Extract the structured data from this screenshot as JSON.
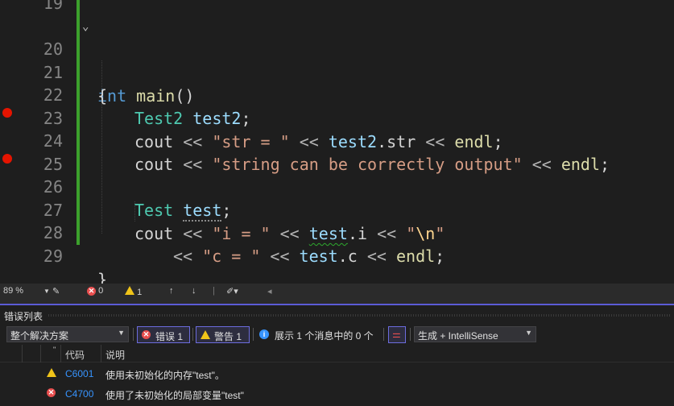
{
  "editor": {
    "lines": [
      {
        "num": "19"
      },
      {
        "num": "20"
      },
      {
        "num": "21"
      },
      {
        "num": "22"
      },
      {
        "num": "23"
      },
      {
        "num": "24"
      },
      {
        "num": "25"
      },
      {
        "num": "26"
      },
      {
        "num": "27"
      },
      {
        "num": "28"
      },
      {
        "num": "29"
      }
    ],
    "tokens": {
      "l20": [
        "int",
        " ",
        "main",
        "()"
      ],
      "l21": [
        "{"
      ],
      "l22": [
        "Test2",
        " ",
        "test2",
        ";"
      ],
      "l23": [
        "cout",
        " << ",
        "\"str = \"",
        " << ",
        "test2",
        ".",
        "str",
        " << ",
        "endl",
        ";"
      ],
      "l24": [
        "cout",
        " << ",
        "\"string can be correctly output\"",
        " << ",
        "endl",
        ";"
      ],
      "l26": [
        "Test",
        " ",
        "test",
        ";"
      ],
      "l27": [
        "cout",
        " << ",
        "\"i = \"",
        " << ",
        "test",
        ".",
        "i",
        " << ",
        "\"",
        "\\n",
        "\""
      ],
      "l28": [
        "<< ",
        "\"c = \"",
        " << ",
        "test",
        ".",
        "c",
        " << ",
        "endl",
        ";"
      ],
      "l29": [
        "}"
      ]
    },
    "fold_glyph": "⌄"
  },
  "statusbar": {
    "zoom": "89 %",
    "errors": "0",
    "warnings": "1",
    "up": "↑",
    "down": "↓",
    "left_arrow": "◂"
  },
  "error_list": {
    "title": "错误列表",
    "scope": "整个解决方案",
    "errors_btn": "错误 1",
    "warnings_btn": "警告 1",
    "messages_btn": "展示 1 个消息中的 0 个",
    "build_filter": "生成 + IntelliSense",
    "columns": {
      "code": "代码",
      "desc": "说明"
    },
    "rows": [
      {
        "type": "warning",
        "code": "C6001",
        "desc": "使用未初始化的内存\"test\"。"
      },
      {
        "type": "error",
        "code": "C4700",
        "desc": "使用了未初始化的局部变量\"test\""
      }
    ]
  },
  "colors": {
    "background": "#1e1e1e",
    "keyword": "#569cd6",
    "type": "#4ec9b0",
    "variable": "#9cdcfe",
    "string": "#d69d85",
    "breakpoint": "#e51400",
    "change_bar": "#3ca02c"
  }
}
